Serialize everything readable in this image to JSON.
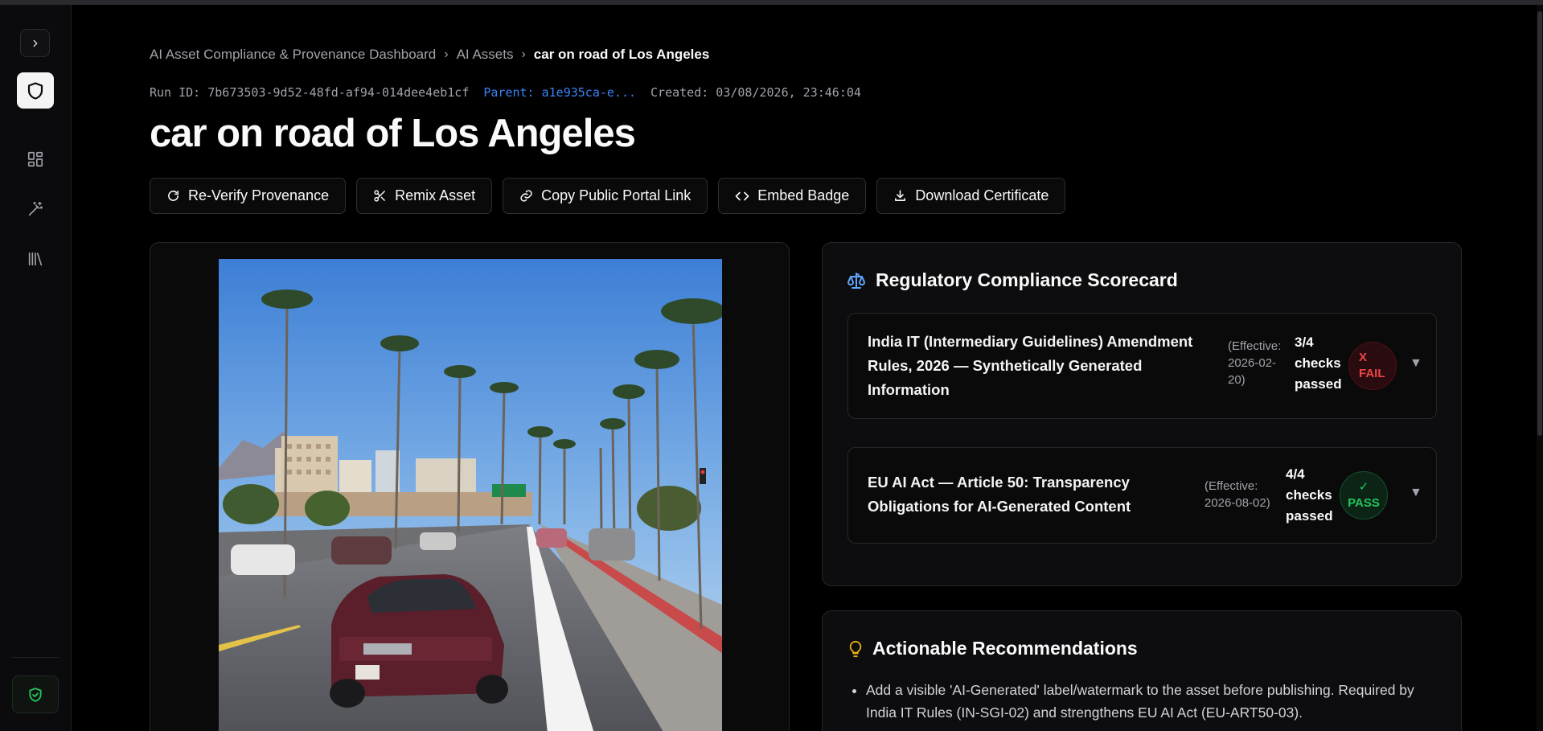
{
  "breadcrumb": {
    "root": "AI Asset Compliance & Provenance Dashboard",
    "section": "AI Assets",
    "current": "car on road of Los Angeles"
  },
  "meta": {
    "run_id": "Run ID: 7b673503-9d52-48fd-af94-014dee4eb1cf",
    "parent": "Parent: a1e935ca-e...",
    "created": "Created: 03/08/2026, 23:46:04"
  },
  "title": "car on road of Los Angeles",
  "actions": {
    "reverify": "Re-Verify Provenance",
    "remix": "Remix Asset",
    "copy_link": "Copy Public Portal Link",
    "embed": "Embed Badge",
    "download": "Download Certificate"
  },
  "scorecard": {
    "heading": "Regulatory Compliance Scorecard",
    "regulations": [
      {
        "name": "India IT (Intermediary Guidelines) Amendment Rules, 2026 — Synthetically Generated Information",
        "effective": "(Effective: 2026-02-20)",
        "checks": "3/4 checks passed",
        "status": "X FAIL",
        "status_color": "#ef4444"
      },
      {
        "name": "EU AI Act — Article 50: Transparency Obligations for AI-Generated Content",
        "effective": "(Effective: 2026-08-02)",
        "checks": "4/4 checks passed",
        "status": "✓ PASS",
        "status_color": "#22c55e"
      }
    ]
  },
  "recommendations": {
    "heading": "Actionable Recommendations",
    "items": [
      "Add a visible 'AI-Generated' label/watermark to the asset before publishing. Required by India IT Rules (IN-SGI-02) and strengthens EU AI Act (EU-ART50-03)."
    ]
  },
  "colors": {
    "accent_link": "#3b82f6",
    "fail": "#ef4444",
    "pass": "#22c55e",
    "rec_icon": "#eab308",
    "scale_icon": "#60a5fa"
  },
  "icons": {
    "sidebar": [
      "chevron-right-icon",
      "shield-icon",
      "dashboard-grid-icon",
      "magic-wand-icon",
      "library-icon",
      "shield-check-icon"
    ],
    "actions": [
      "refresh-icon",
      "scissors-icon",
      "link-icon",
      "code-icon",
      "download-icon"
    ],
    "scorecard": "scale-icon",
    "recommendations": "lightbulb-icon"
  }
}
